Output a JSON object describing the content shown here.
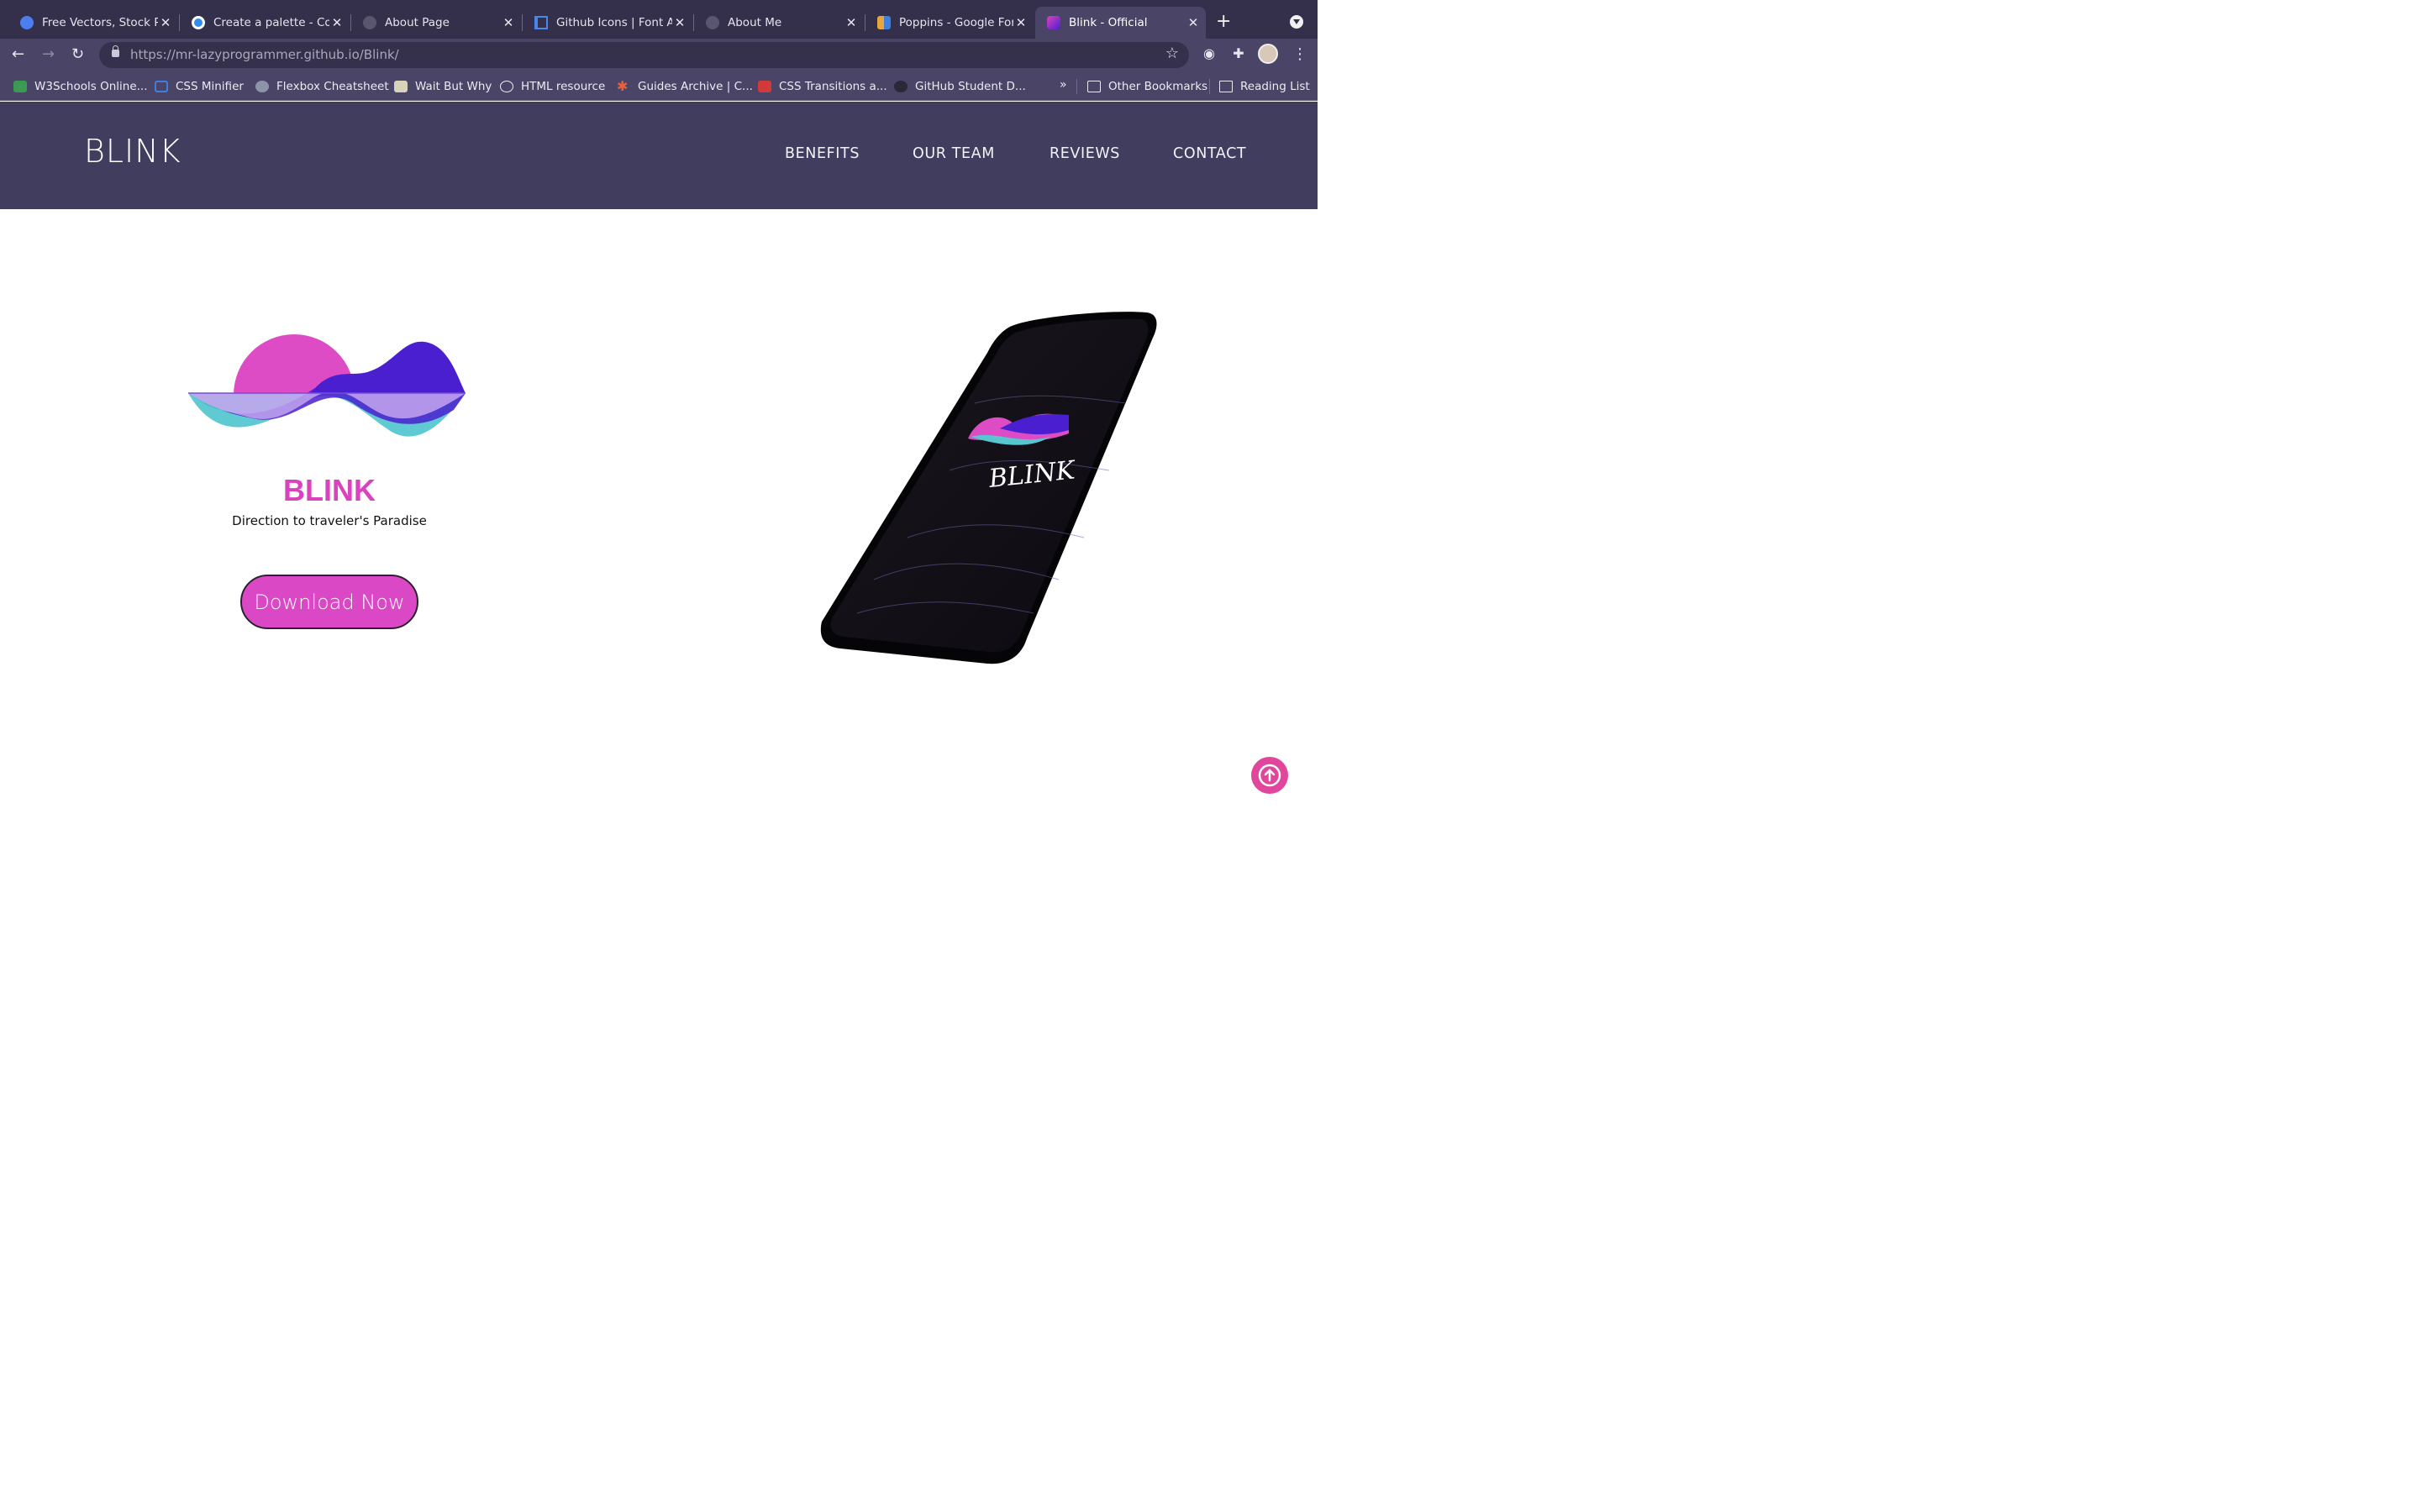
{
  "browser": {
    "tabs": [
      {
        "title": "Free Vectors, Stock P",
        "icon": "freepik-icon",
        "color": "#4c7ef0"
      },
      {
        "title": "Create a palette - Coo",
        "icon": "coolors-icon",
        "color": "#2f8cf0"
      },
      {
        "title": "About Page",
        "icon": "globe-icon",
        "color": "#5a5670"
      },
      {
        "title": "Github Icons | Font Aw",
        "icon": "flag-icon",
        "color": "#4a86e8"
      },
      {
        "title": "About Me",
        "icon": "globe-icon",
        "color": "#5a5670"
      },
      {
        "title": "Poppins - Google Fon",
        "icon": "google-fonts-icon",
        "color": "#e8a53a"
      },
      {
        "title": "Blink - Official",
        "icon": "blink-icon",
        "color": "#b455e8",
        "active": true
      }
    ],
    "new_tab": "+",
    "url_host": "https://mr-lazyprogrammer.github.io",
    "url_path": "/Blink/",
    "bookmarks": [
      {
        "label": "W3Schools Online...",
        "icon": "w3schools-icon",
        "color": "#3a9a52"
      },
      {
        "label": "CSS Minifier",
        "icon": "css-icon",
        "color": "#3f7fe0"
      },
      {
        "label": "Flexbox Cheatsheet",
        "icon": "flexbox-icon",
        "color": "#8f93a8"
      },
      {
        "label": "Wait But Why",
        "icon": "waitbutwhy-icon",
        "color": "#d8d2b8"
      },
      {
        "label": "HTML resource",
        "icon": "html-icon",
        "color": "#24222e"
      },
      {
        "label": "Guides Archive | C...",
        "icon": "asterisk-icon",
        "color": "#e8603a"
      },
      {
        "label": "CSS Transitions a...",
        "icon": "css-tricks-icon",
        "color": "#d23a3a"
      },
      {
        "label": "GitHub Student D...",
        "icon": "github-icon",
        "color": "#2a2836"
      }
    ],
    "bookmarks_more": "»",
    "other_bookmarks": "Other Bookmarks",
    "reading_list": "Reading List"
  },
  "site": {
    "logo": "BLINK",
    "nav": [
      "BENEFITS",
      "OUR TEAM",
      "REVIEWS",
      "CONTACT"
    ],
    "hero": {
      "title": "BLINK",
      "subtitle": "Direction to traveler's Paradise",
      "cta": "Download Now",
      "phone_brand": "BLINK"
    },
    "colors": {
      "header": "#413d5e",
      "accent_pink": "#d943be",
      "purple": "#4a1fd0",
      "cyan": "#4cc8d0",
      "lavender": "#c5a4f0"
    }
  }
}
